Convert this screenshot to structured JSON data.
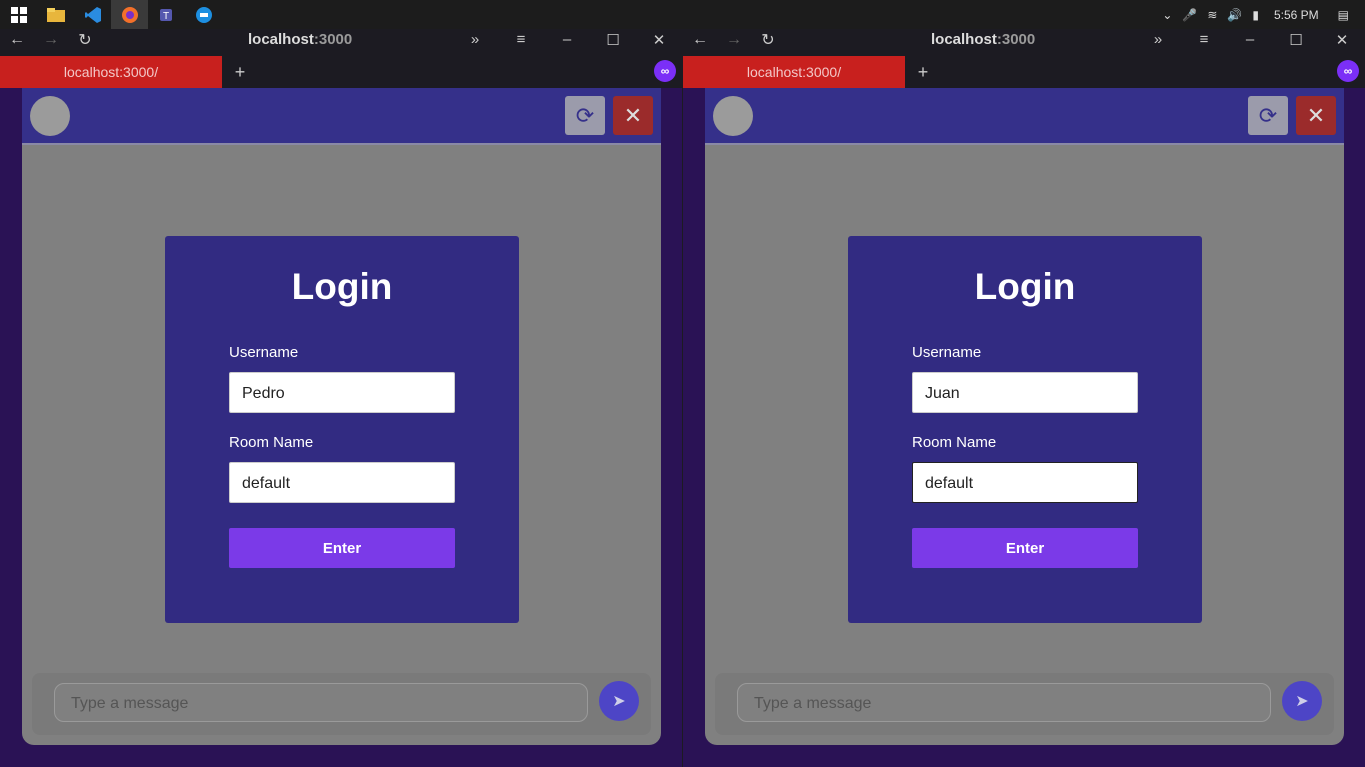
{
  "taskbar": {
    "time": "5:56 PM"
  },
  "windows": [
    {
      "title_host": "localhost",
      "title_port": ":3000",
      "tab_label": "localhost:3000/",
      "login": {
        "title": "Login",
        "username_label": "Username",
        "username_value": "Pedro",
        "room_label": "Room Name",
        "room_value": "default",
        "enter_label": "Enter"
      },
      "message_placeholder": "Type a message"
    },
    {
      "title_host": "localhost",
      "title_port": ":3000",
      "tab_label": "localhost:3000/",
      "login": {
        "title": "Login",
        "username_label": "Username",
        "username_value": "Juan",
        "room_label": "Room Name",
        "room_value": "default",
        "enter_label": "Enter"
      },
      "message_placeholder": "Type a message"
    }
  ],
  "colors": {
    "header": "#35308a",
    "login_box": "#322b82",
    "enter_button": "#7b3ae8",
    "tab_active": "#c8201e"
  }
}
